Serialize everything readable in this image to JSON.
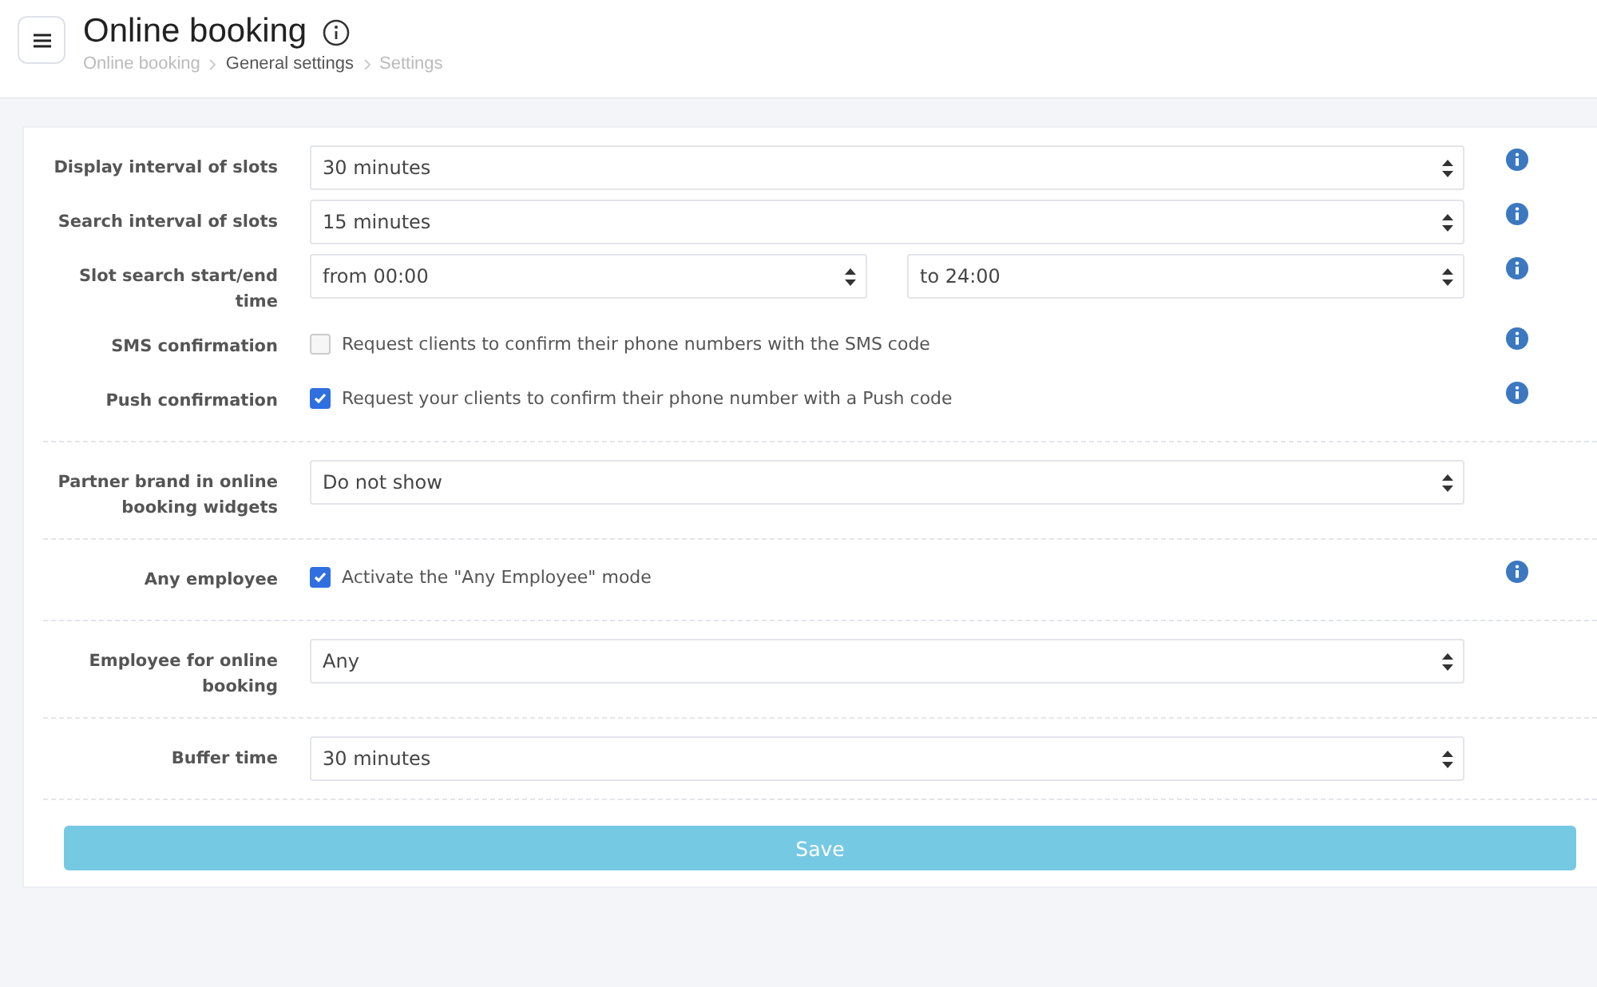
{
  "header": {
    "title": "Online booking",
    "breadcrumbs": [
      {
        "label": "Online booking",
        "selected": false
      },
      {
        "label": "General settings",
        "selected": true
      },
      {
        "label": "Settings",
        "selected": false
      }
    ]
  },
  "sections": [
    {
      "rows": [
        {
          "kind": "select",
          "label": "Display interval of slots",
          "value": "30 minutes",
          "info": true
        },
        {
          "kind": "select",
          "label": "Search interval of slots",
          "value": "15 minutes",
          "info": true
        },
        {
          "kind": "range",
          "label": "Slot search start/end time",
          "from": "from 00:00",
          "to": "to 24:00",
          "info": true
        },
        {
          "kind": "checkbox",
          "label": "SMS confirmation",
          "text": "Request clients to confirm their phone numbers with the SMS code",
          "checked": false,
          "info": true
        },
        {
          "kind": "checkbox",
          "label": "Push confirmation",
          "text": "Request your clients to confirm their phone number with a Push code",
          "checked": true,
          "info": true
        }
      ]
    },
    {
      "rows": [
        {
          "kind": "select",
          "label": "Partner brand in online booking widgets",
          "value": "Do not show",
          "info": false
        }
      ]
    },
    {
      "rows": [
        {
          "kind": "checkbox",
          "label": "Any employee",
          "text": "Activate the \"Any Employee\" mode",
          "checked": true,
          "info": true
        }
      ]
    },
    {
      "rows": [
        {
          "kind": "select",
          "label": "Employee for online booking",
          "value": "Any",
          "info": false
        }
      ]
    },
    {
      "rows": [
        {
          "kind": "select",
          "label": "Buffer time",
          "value": "30 minutes",
          "info": false
        }
      ]
    }
  ],
  "save_button": "Save"
}
